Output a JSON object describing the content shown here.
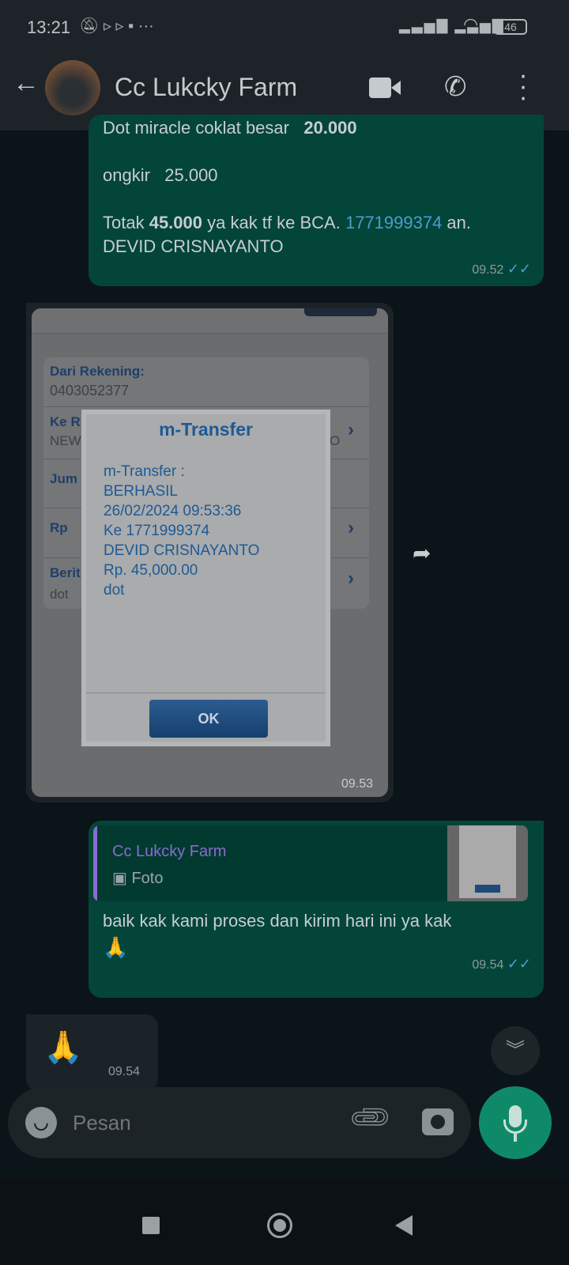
{
  "status": {
    "time": "13:21",
    "battery": "46"
  },
  "header": {
    "title": "Cc Lukcky Farm"
  },
  "messages": {
    "m1": {
      "line1": "Dot miracle coklat besar",
      "line1_bold": "20.000",
      "line2": "ongkir   25.000",
      "line3a": "Totak ",
      "line3_bold": "45.000",
      "line3b": " ya kak tf ke BCA. ",
      "line3_link": "1771999374",
      "line3c": " an.",
      "line4": "DEVID CRISNAYANTO",
      "time": "09.52"
    },
    "m2": {
      "time": "09.53",
      "form": {
        "dari_label": "Dari Rekening:",
        "dari_value": "0403052377",
        "ke_label": "Ke R",
        "ke_value": "NEW",
        "ke_tail": "O",
        "jum_label": "Jum",
        "rp_label": "Rp",
        "berita_label": "Berit",
        "berita_value": "dot"
      },
      "dialog": {
        "title": "m-Transfer",
        "lines": [
          "m-Transfer :",
          "BERHASIL",
          "26/02/2024 09:53:36",
          "Ke 1771999374",
          "DEVID CRISNAYANTO",
          "Rp. 45,000.00",
          "dot"
        ],
        "ok": "OK"
      }
    },
    "m3": {
      "quote_name": "Cc Lukcky Farm",
      "quote_type": "Foto",
      "text": "baik kak kami proses dan kirim hari ini ya kak",
      "emoji": "🙏",
      "time": "09.54"
    },
    "m4": {
      "emoji": "🙏",
      "time": "09.54"
    }
  },
  "input": {
    "placeholder": "Pesan"
  },
  "colors": {
    "out_bubble": "#034538",
    "in_bubble": "#1c2328",
    "accent": "#0f8a69",
    "link": "#4b9dd0"
  }
}
